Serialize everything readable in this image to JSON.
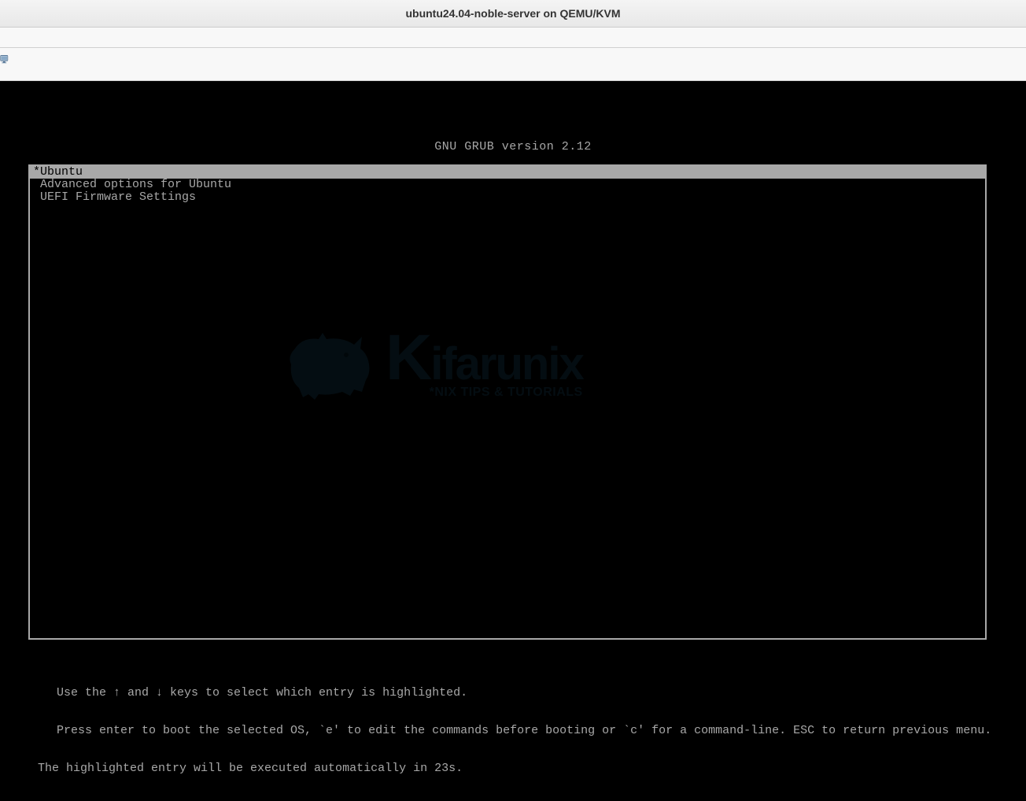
{
  "window": {
    "title": "ubuntu24.04-noble-server on QEMU/KVM"
  },
  "grub": {
    "header": "GNU GRUB  version 2.12",
    "menu": [
      {
        "label": "*Ubuntu",
        "selected": true
      },
      {
        "label": " Advanced options for Ubuntu",
        "selected": false
      },
      {
        "label": " UEFI Firmware Settings",
        "selected": false
      }
    ],
    "help_line1": "Use the ↑ and ↓ keys to select which entry is highlighted.",
    "help_line2": "Press enter to boot the selected OS, `e' to edit the commands before booting or `c' for a command-line. ESC to return previous menu.",
    "help_line3": "The highlighted entry will be executed automatically in 23s."
  },
  "watermark": {
    "title": "Kifarunix",
    "subtitle": "*NIX TIPS & TUTORIALS"
  }
}
